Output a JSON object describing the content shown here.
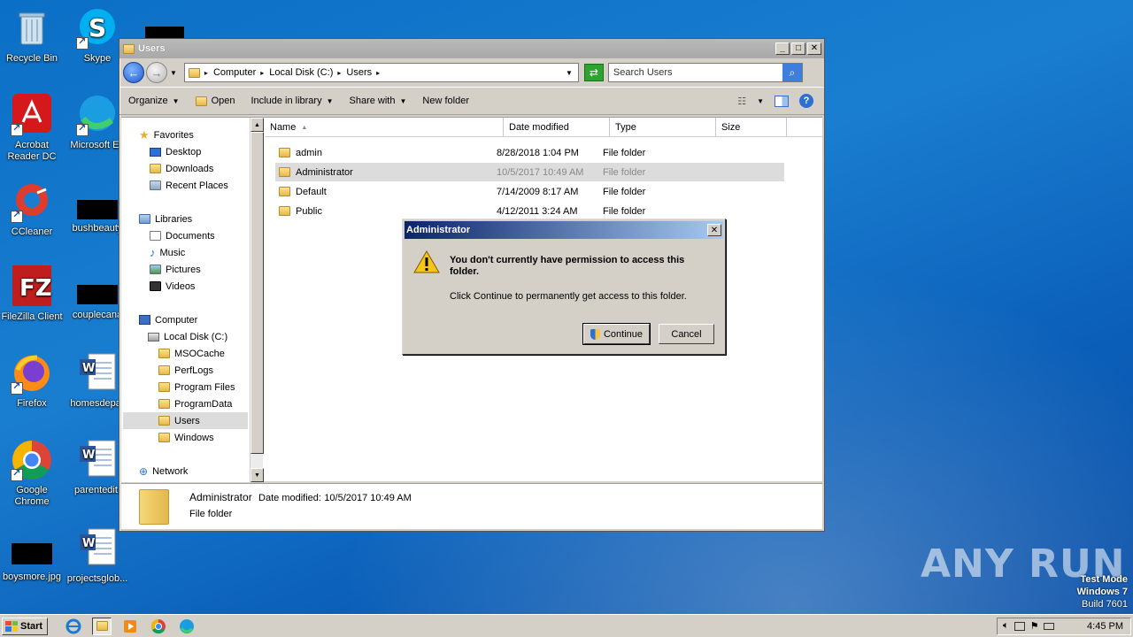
{
  "desktop": {
    "icons": [
      {
        "label": "Recycle Bin"
      },
      {
        "label": "Skype"
      },
      {
        "label": "Acrobat Reader DC"
      },
      {
        "label": "Microsoft Ed"
      },
      {
        "label": "CCleaner"
      },
      {
        "label": "bushbeauty"
      },
      {
        "label": "FileZilla Client"
      },
      {
        "label": "couplecana"
      },
      {
        "label": "Firefox"
      },
      {
        "label": "homesdepar"
      },
      {
        "label": "Google Chrome"
      },
      {
        "label": "parentedit."
      },
      {
        "label": "boysmore.jpg"
      },
      {
        "label": "projectsglob..."
      }
    ]
  },
  "explorer": {
    "title": "Users",
    "address": [
      "Computer",
      "Local Disk (C:)",
      "Users"
    ],
    "search_placeholder": "Search Users",
    "toolbar": {
      "organize": "Organize",
      "open": "Open",
      "include": "Include in library",
      "share": "Share with",
      "new_folder": "New folder"
    },
    "nav": {
      "favorites": "Favorites",
      "desktop": "Desktop",
      "downloads": "Downloads",
      "recent": "Recent Places",
      "libraries": "Libraries",
      "documents": "Documents",
      "music": "Music",
      "pictures": "Pictures",
      "videos": "Videos",
      "computer": "Computer",
      "local_disk": "Local Disk (C:)",
      "msocache": "MSOCache",
      "perflogs": "PerfLogs",
      "program_files": "Program Files",
      "programdata": "ProgramData",
      "users": "Users",
      "windows": "Windows",
      "network": "Network"
    },
    "columns": {
      "name": "Name",
      "date": "Date modified",
      "type": "Type",
      "size": "Size"
    },
    "files": [
      {
        "name": "admin",
        "date": "8/28/2018 1:04 PM",
        "type": "File folder"
      },
      {
        "name": "Administrator",
        "date": "10/5/2017 10:49 AM",
        "type": "File folder"
      },
      {
        "name": "Default",
        "date": "7/14/2009 8:17 AM",
        "type": "File folder"
      },
      {
        "name": "Public",
        "date": "4/12/2011 3:24 AM",
        "type": "File folder"
      }
    ],
    "details": {
      "name": "Administrator",
      "date_label": "Date modified:",
      "date_value": "10/5/2017 10:49 AM",
      "type": "File folder"
    }
  },
  "dialog": {
    "title": "Administrator",
    "message": "You don't currently have permission to access this folder.",
    "sub": "Click Continue to permanently get access to this folder.",
    "continue": "Continue",
    "cancel": "Cancel"
  },
  "taskbar": {
    "start": "Start",
    "clock": "4:45 PM"
  },
  "watermark": {
    "brand": "ANY  RUN",
    "line1": "Test Mode",
    "line2": "Windows 7",
    "line3": "Build 7601"
  }
}
